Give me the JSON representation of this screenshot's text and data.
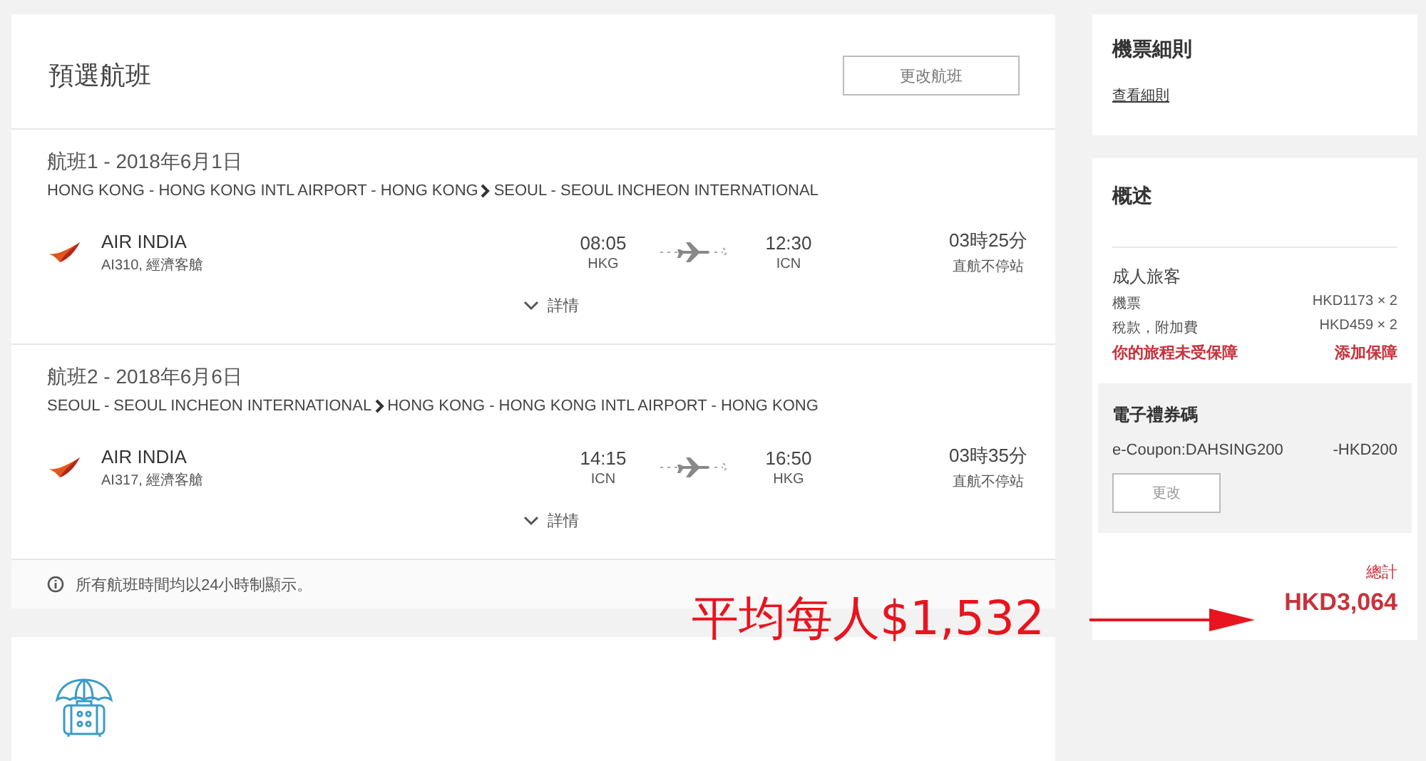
{
  "selected_flights": {
    "title": "預選航班",
    "change_button": "更改航班",
    "flights": [
      {
        "heading": "航班1 - 2018年6月1日",
        "origin": "HONG KONG - HONG KONG INTL AIRPORT - HONG KONG",
        "destination": "SEOUL - SEOUL INCHEON INTERNATIONAL",
        "airline": "AIR INDIA",
        "flight_info": "AI310, 經濟客艙",
        "depart_time": "08:05",
        "depart_code": "HKG",
        "arrive_time": "12:30",
        "arrive_code": "ICN",
        "duration": "03時25分",
        "stops": "直航不停站",
        "details": "詳情"
      },
      {
        "heading": "航班2 - 2018年6月6日",
        "origin": "SEOUL - SEOUL INCHEON INTERNATIONAL",
        "destination": "HONG KONG - HONG KONG INTL AIRPORT - HONG KONG",
        "airline": "AIR INDIA",
        "flight_info": "AI317, 經濟客艙",
        "depart_time": "14:15",
        "depart_code": "ICN",
        "arrive_time": "16:50",
        "arrive_code": "HKG",
        "duration": "03時35分",
        "stops": "直航不停站",
        "details": "詳情"
      }
    ],
    "note": "所有航班時間均以24小時制顯示。"
  },
  "ticket_rules": {
    "title": "機票細則",
    "link": "查看細則"
  },
  "summary": {
    "title": "概述",
    "group": "成人旅客",
    "lines": [
      {
        "label": "機票",
        "value": "HKD1173 × 2"
      },
      {
        "label": "稅款，附加費",
        "value": "HKD459 × 2"
      }
    ],
    "insurance_warning": "你的旅程未受保障",
    "insurance_link": "添加保障",
    "coupon": {
      "title": "電子禮券碼",
      "code": "e-Coupon:DAHSING200",
      "amount": "-HKD200",
      "button": "更改"
    },
    "total_label": "總計",
    "total": "HKD3,064"
  },
  "annotation": {
    "text": "平均每人$1,532"
  }
}
